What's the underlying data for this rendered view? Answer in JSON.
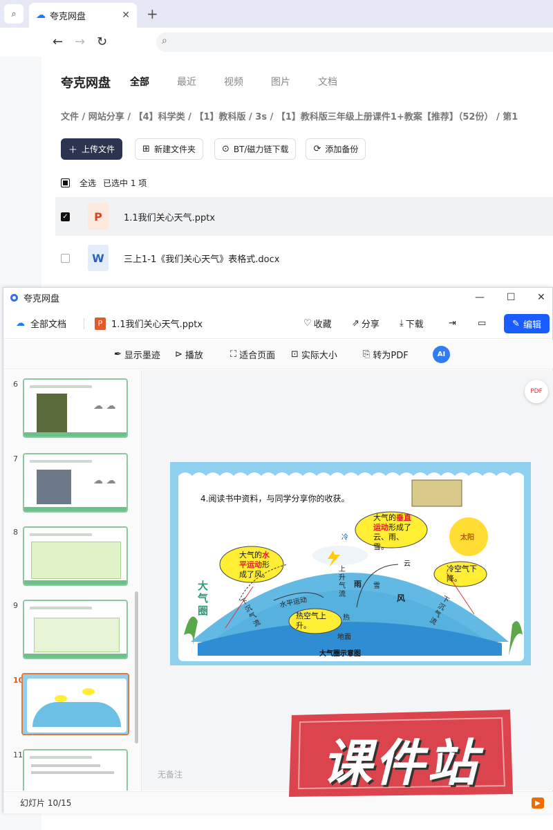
{
  "browser": {
    "tab_title": "夸克网盘",
    "new_tab": "+",
    "close": "✕"
  },
  "page": {
    "brand": "夸克网盘",
    "tabs": [
      {
        "label": "全部",
        "active": true
      },
      {
        "label": "最近"
      },
      {
        "label": "视频"
      },
      {
        "label": "图片"
      },
      {
        "label": "文档"
      }
    ],
    "breadcrumb": "文件 / 网站分享 / 【4】科学类 / 【1】教科版 / 3s / 【1】教科版三年级上册课件1+教案【推荐】（52份） / 第1",
    "actions": {
      "upload": "上传文件",
      "new_folder": "新建文件夹",
      "bt": "BT/磁力链下载",
      "backup": "添加备份"
    },
    "select_all": "全选",
    "selected_info": "已选中  1  项",
    "files": [
      {
        "name": "1.1我们关心天气.pptx",
        "type": "ppt",
        "icon_letter": "P",
        "selected": true
      },
      {
        "name": "三上1-1《我们关心天气》表格式.docx",
        "type": "doc",
        "icon_letter": "W",
        "selected": false
      }
    ]
  },
  "viewer": {
    "window_title": "夸克网盘",
    "all_docs": "全部文档",
    "file_name": "1.1我们关心天气.pptx",
    "file_icon": "P",
    "favorite": "收藏",
    "share": "分享",
    "download": "下载",
    "edit": "编辑",
    "toolbar": {
      "ink": "显示墨迹",
      "play": "播放",
      "fit": "适合页面",
      "actual": "实际大小",
      "to_pdf": "转为PDF",
      "ai": "AI"
    },
    "thumbnails": [
      {
        "num": "6"
      },
      {
        "num": "7"
      },
      {
        "num": "8"
      },
      {
        "num": "9"
      },
      {
        "num": "10",
        "active": true
      },
      {
        "num": "11"
      }
    ],
    "notes": "无备注",
    "status": "幻灯片 10/15",
    "pdf_badge": "PDF"
  },
  "slide": {
    "heading": "4.阅读书中资料，与同学分享你的收获。",
    "bubble_vertical": [
      "大气的",
      "垂直",
      "运动",
      "形成了",
      "云、雨、雪。"
    ],
    "bubble_horizontal": [
      "大气的",
      "水",
      "平运动",
      "形",
      "成了风。"
    ],
    "bubble_cold": "冷空气下降。",
    "bubble_hot": "热空气上升。",
    "sun": "太阳",
    "cold": "冷",
    "cloud": "云",
    "rain": "雨",
    "snow": "雪",
    "wind": "风",
    "hot": "热",
    "ground": "地面",
    "rising": "上升气流",
    "left_sink": "下沉气流",
    "right_sink": "下沉气流",
    "horizontal": "水平运动",
    "atmosphere": "大气圈",
    "caption": "大气圈示意图"
  },
  "watermark": {
    "text": "课件站"
  },
  "colors": {
    "accent": "#1a5cff",
    "primary_dark": "#2d3450",
    "highlight_red": "#e02020",
    "bubble_yellow": "#ffee33"
  }
}
